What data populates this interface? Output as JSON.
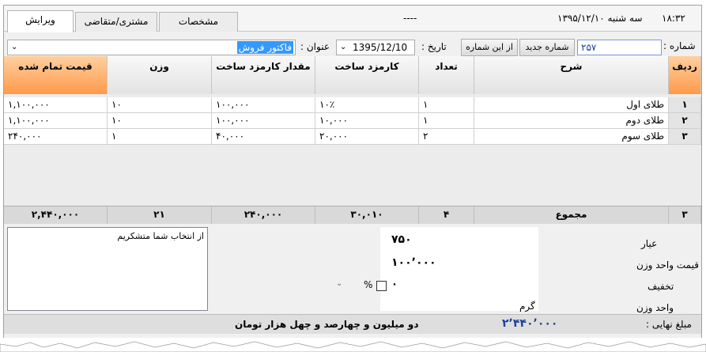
{
  "header": {
    "time": "۱۸:۳۲",
    "date": "سه شنبه ۱۳۹۵/۱۲/۱۰",
    "center": "----",
    "tabs": [
      "ویرایش",
      "مشتری/متقاضی",
      "مشخصات"
    ]
  },
  "form": {
    "number_label": "شماره :",
    "number_value": "۲۵۷",
    "new_number_button": "شماره جدید",
    "from_this_number_button": "از این شماره",
    "date_label": "تاریخ :",
    "date_value": "1395/12/10",
    "title_label": "عنوان :",
    "title_value": "فاکتور فروش"
  },
  "table": {
    "columns": [
      "ردیف",
      "شرح",
      "تعداد",
      "کارمزد ساخت",
      "مقدار کارمزد ساخت",
      "وزن",
      "قیمت تمام شده"
    ],
    "rows": [
      {
        "index": "۱",
        "desc": "طلای اول",
        "qty": "۱",
        "fee": "۱۰٪",
        "fee_amount": "۱۰۰,۰۰۰",
        "weight": "۱۰",
        "total": "۱,۱۰۰,۰۰۰"
      },
      {
        "index": "۲",
        "desc": "طلای دوم",
        "qty": "۱",
        "fee": "۱۰,۰۰۰",
        "fee_amount": "۱۰۰,۰۰۰",
        "weight": "۱۰",
        "total": "۱,۱۰۰,۰۰۰"
      },
      {
        "index": "۳",
        "desc": "طلای سوم",
        "qty": "۲",
        "fee": "۲۰,۰۰۰",
        "fee_amount": "۴۰,۰۰۰",
        "weight": "۱",
        "total": "۲۴۰,۰۰۰"
      }
    ],
    "totals": {
      "index": "۳",
      "label": "مجموع",
      "qty": "۴",
      "fee": "۳۰,۰۱۰",
      "fee_amount": "۲۴۰,۰۰۰",
      "weight": "۲۱",
      "total": "۲,۴۴۰,۰۰۰"
    }
  },
  "summary": {
    "ayar_label": "عیار",
    "ayar_value": "۷۵۰",
    "unit_price_label": "قیمت واحد وزن",
    "unit_price_value": "۱۰۰٬۰۰۰",
    "discount_label": "تخفیف",
    "discount_value": "۰",
    "discount_percent": "%",
    "weight_unit_label": "واحد وزن",
    "weight_unit_value": "گرم",
    "memo": "از انتخاب شما متشکریم",
    "final_label": "مبلغ نهایی :",
    "final_value": "۲٬۴۴۰٬۰۰۰",
    "final_words": "دو میلیون و چهارصد و چهل  هزار  تومان"
  }
}
